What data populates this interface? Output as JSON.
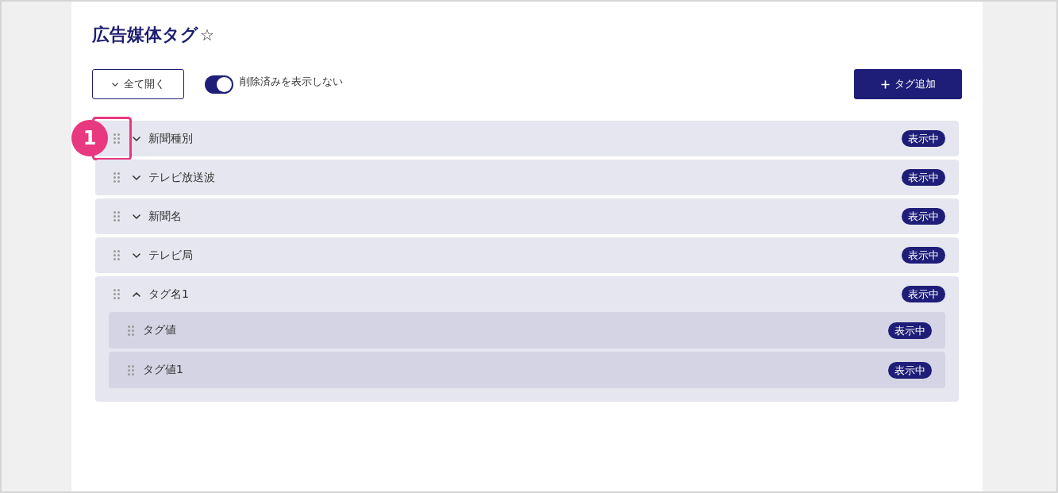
{
  "page": {
    "title": "広告媒体タグ",
    "star": "☆"
  },
  "toolbar": {
    "expand_all_button": {
      "label": "全て開く"
    },
    "hide_deleted_toggle": {
      "label": "削除済みを表示しない",
      "on": true
    },
    "add_button": {
      "label": "タグ追加"
    }
  },
  "tags": [
    {
      "name": "新聞種別",
      "expanded": false,
      "badge": "表示中",
      "callout": "1"
    },
    {
      "name": "テレビ放送波",
      "expanded": false,
      "badge": "表示中"
    },
    {
      "name": "新聞名",
      "expanded": false,
      "badge": "表示中"
    },
    {
      "name": "テレビ局",
      "expanded": false,
      "badge": "表示中"
    },
    {
      "name": "タグ名1",
      "expanded": true,
      "badge": "表示中",
      "children": [
        {
          "name": "タグ値",
          "badge": "表示中"
        },
        {
          "name": "タグ値1",
          "badge": "表示中"
        }
      ]
    }
  ]
}
